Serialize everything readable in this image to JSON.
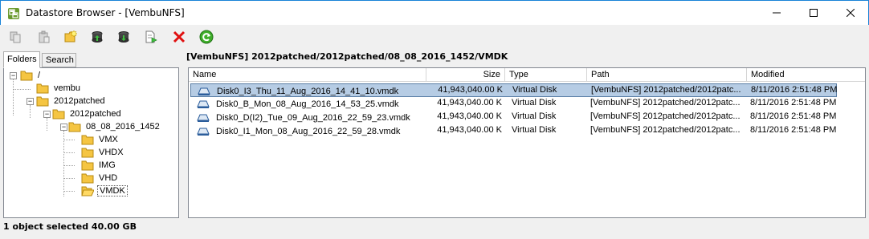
{
  "window": {
    "title": "Datastore Browser - [VembuNFS]",
    "accent": "#1883d7"
  },
  "toolbar": {
    "buttons": [
      "copy-icon",
      "paste-icon",
      "new-folder-icon",
      "upload-icon",
      "download-icon",
      "register-vm-icon",
      "delete-icon",
      "refresh-icon"
    ]
  },
  "tabs": {
    "folders": "Folders",
    "search": "Search"
  },
  "tree": {
    "nodes": [
      {
        "label": "/",
        "toggle": "−"
      },
      {
        "label": "vembu"
      },
      {
        "label": "2012patched",
        "toggle": "−"
      },
      {
        "label": "2012patched",
        "toggle": "−"
      },
      {
        "label": "08_08_2016_1452",
        "toggle": "−"
      },
      {
        "label": "VMX"
      },
      {
        "label": "VHDX"
      },
      {
        "label": "IMG"
      },
      {
        "label": "VHD"
      },
      {
        "label": "VMDK",
        "selected": true
      }
    ]
  },
  "path": "[VembuNFS] 2012patched/2012patched/08_08_2016_1452/VMDK",
  "grid": {
    "columns": {
      "name": "Name",
      "size": "Size",
      "type": "Type",
      "path": "Path",
      "modified": "Modified"
    },
    "rows": [
      {
        "name": "Disk0_I3_Thu_11_Aug_2016_14_41_10.vmdk",
        "size": "41,943,040.00 K",
        "type": "Virtual Disk",
        "path": "[VembuNFS] 2012patched/2012patc...",
        "modified": "8/11/2016 2:51:48 PM",
        "selected": true
      },
      {
        "name": "Disk0_B_Mon_08_Aug_2016_14_53_25.vmdk",
        "size": "41,943,040.00 K",
        "type": "Virtual Disk",
        "path": "[VembuNFS] 2012patched/2012patc...",
        "modified": "8/11/2016 2:51:48 PM"
      },
      {
        "name": "Disk0_D(I2)_Tue_09_Aug_2016_22_59_23.vmdk",
        "size": "41,943,040.00 K",
        "type": "Virtual Disk",
        "path": "[VembuNFS] 2012patched/2012patc...",
        "modified": "8/11/2016 2:51:48 PM"
      },
      {
        "name": "Disk0_I1_Mon_08_Aug_2016_22_59_28.vmdk",
        "size": "41,943,040.00 K",
        "type": "Virtual Disk",
        "path": "[VembuNFS] 2012patched/2012patc...",
        "modified": "8/11/2016 2:51:48 PM"
      }
    ]
  },
  "status": "1 object selected 40.00 GB"
}
